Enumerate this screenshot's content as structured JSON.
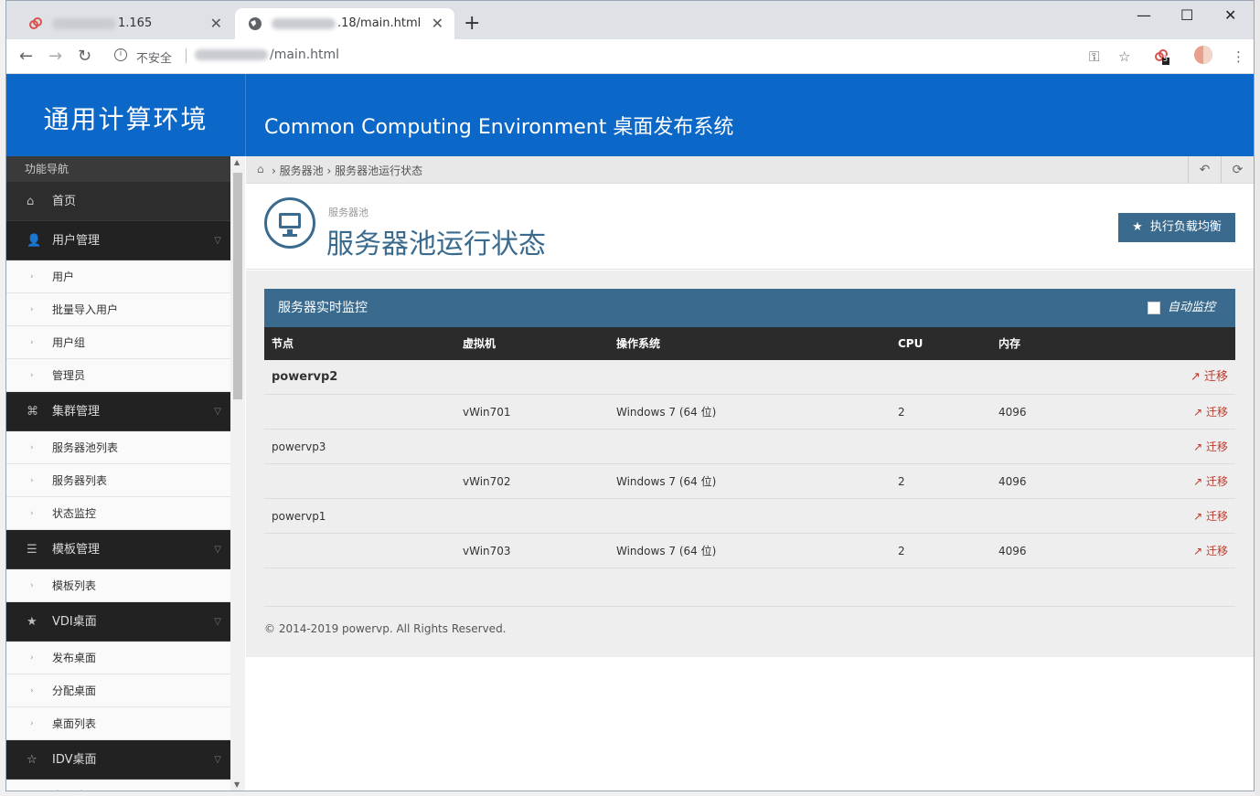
{
  "browser": {
    "tabs": [
      {
        "title": "1.165",
        "active": false
      },
      {
        "title": ".18/main.html",
        "active": true
      }
    ],
    "new_tab": "+",
    "window_controls": {
      "minimize": "—",
      "maximize": "☐",
      "close": "✕"
    },
    "insecure_label": "不安全",
    "url": "/main.html",
    "extension_badge": "5"
  },
  "app": {
    "system_name": "通用计算环境",
    "subtitle": "Common Computing Environment 桌面发布系统"
  },
  "sidebar": {
    "header": "功能导航",
    "home": "首页",
    "groups": [
      {
        "label": "用户管理",
        "icon": "user-icon",
        "items": [
          "用户",
          "批量导入用户",
          "用户组",
          "管理员"
        ]
      },
      {
        "label": "集群管理",
        "icon": "sitemap-icon",
        "items": [
          "服务器池列表",
          "服务器列表",
          "状态监控"
        ]
      },
      {
        "label": "模板管理",
        "icon": "list-icon",
        "items": [
          "模板列表"
        ]
      },
      {
        "label": "VDI桌面",
        "icon": "star-icon",
        "items": [
          "发布桌面",
          "分配桌面",
          "桌面列表"
        ]
      },
      {
        "label": "IDV桌面",
        "icon": "star-outline-icon",
        "items": [
          "桌面池"
        ]
      }
    ]
  },
  "breadcrumb": {
    "items": [
      "服务器池",
      "服务器池运行状态"
    ]
  },
  "page": {
    "small_title": "服务器池",
    "title": "服务器池运行状态",
    "balance_button": "执行负载均衡"
  },
  "panel": {
    "title": "服务器实时监控",
    "auto_monitor": "自动监控",
    "columns": [
      "节点",
      "虚拟机",
      "操作系统",
      "CPU",
      "内存"
    ],
    "migrate_label": "迁移",
    "rows": [
      {
        "node": "powervp2",
        "vm": "",
        "os": "",
        "cpu": "",
        "mem": "",
        "strong": true
      },
      {
        "node": "",
        "vm": "vWin701",
        "os": "Windows 7 (64 位)",
        "cpu": "2",
        "mem": "4096",
        "strong": false
      },
      {
        "node": "powervp3",
        "vm": "",
        "os": "",
        "cpu": "",
        "mem": "",
        "strong": false
      },
      {
        "node": "",
        "vm": "vWin702",
        "os": "Windows 7 (64 位)",
        "cpu": "2",
        "mem": "4096",
        "strong": false
      },
      {
        "node": "powervp1",
        "vm": "",
        "os": "",
        "cpu": "",
        "mem": "",
        "strong": false
      },
      {
        "node": "",
        "vm": "vWin703",
        "os": "Windows 7 (64 位)",
        "cpu": "2",
        "mem": "4096",
        "strong": false
      }
    ]
  },
  "footer": "© 2014-2019 powervp. All Rights Reserved.",
  "colors": {
    "brand": "#0b67c8",
    "panel": "#3a6b8e",
    "danger": "#c0392b"
  }
}
